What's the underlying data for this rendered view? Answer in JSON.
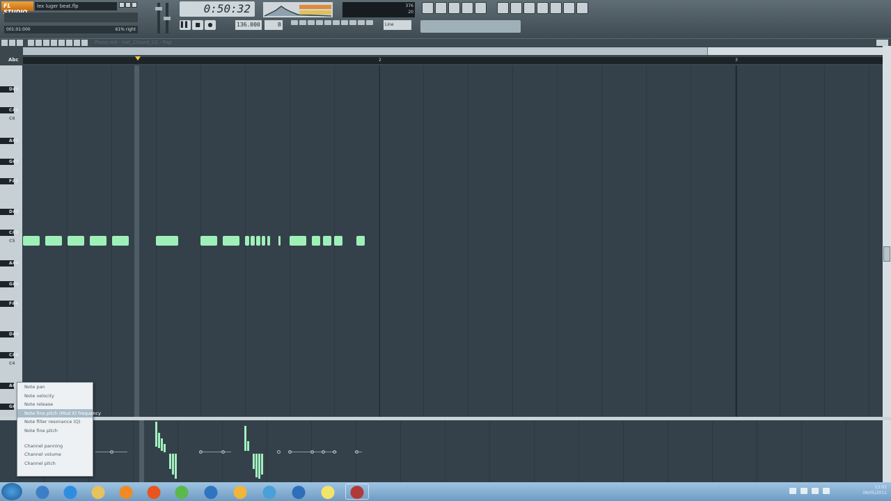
{
  "app": {
    "logo": "FL STUDIO",
    "filename": "lex luger beat.flp",
    "hint": "",
    "position_readout": "001:01:000",
    "pan_readout": "61% right"
  },
  "transport": {
    "time": "0:50:32",
    "tempo": "136.000",
    "pattern": "8",
    "buttons": [
      "▌▌",
      "■",
      "●"
    ],
    "line_mode": "Line",
    "meter_readout": [
      "376",
      "20"
    ]
  },
  "piano_roll": {
    "title": "Piano roll - Hat_Closed_02 - Pap",
    "tool_icon": "Abc",
    "bar_numbers": [
      "2",
      "3"
    ],
    "key_labels": [
      {
        "name": "D#6",
        "black": true
      },
      {
        "name": "C#6",
        "black": true
      },
      {
        "name": "C6",
        "black": false
      },
      {
        "name": "A#5",
        "black": true
      },
      {
        "name": "G#5",
        "black": true
      },
      {
        "name": "F#5",
        "black": true
      },
      {
        "name": "D#5",
        "black": true
      },
      {
        "name": "C#5",
        "black": true
      },
      {
        "name": "C5",
        "black": false
      },
      {
        "name": "A#4",
        "black": true
      },
      {
        "name": "G#4",
        "black": true
      },
      {
        "name": "F#4",
        "black": true
      },
      {
        "name": "D#4",
        "black": true
      },
      {
        "name": "C#4",
        "black": true
      },
      {
        "name": "C4",
        "black": false
      },
      {
        "name": "A#3",
        "black": true
      },
      {
        "name": "G#3",
        "black": true
      }
    ]
  },
  "context_menu": {
    "items": [
      "Note pan",
      "Note velocity",
      "Note release",
      "Note fine pitch (Mod X) frequency",
      "Note filter resonance (Q)",
      "Note fine pitch",
      "",
      "Channel panning",
      "Channel volume",
      "Channel pitch"
    ],
    "highlighted_index": 3
  },
  "taskbar": {
    "apps": [
      "windows-explorer",
      "internet-explorer",
      "folder",
      "media-player",
      "firefox",
      "chrome",
      "itunes",
      "fl-studio",
      "messenger",
      "winamp",
      "sticky-notes",
      "winrar",
      "fl-studio-active"
    ],
    "clock_time": "13:01",
    "clock_date": "06/05/2011"
  },
  "colors": {
    "note": "#9ff0b8",
    "grid_bg": "#34414a",
    "playhead": "#f5c842"
  }
}
